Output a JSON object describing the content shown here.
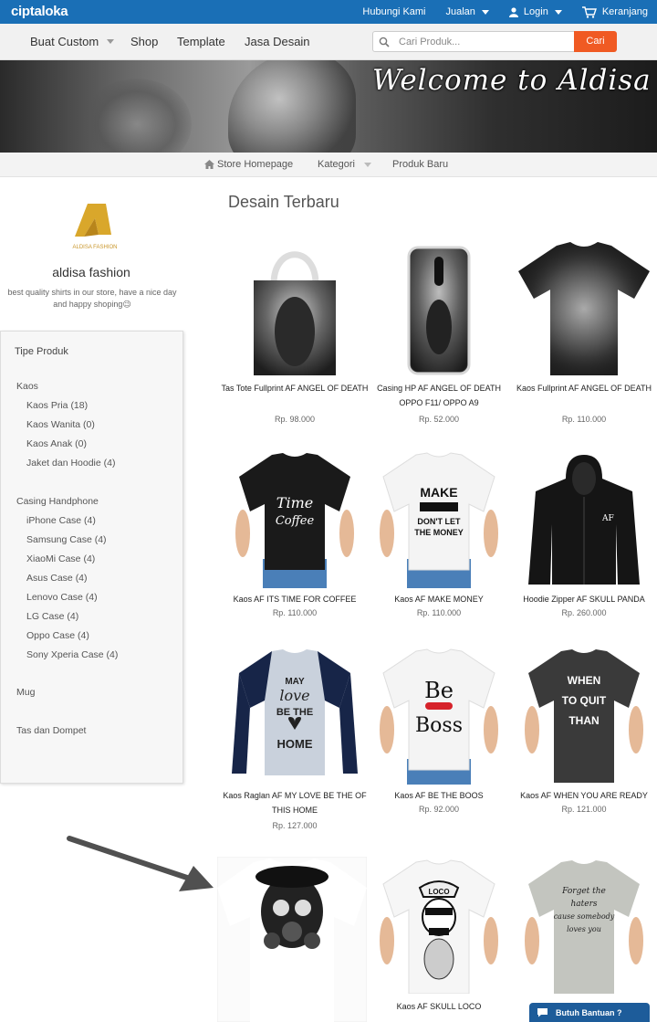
{
  "topbar": {
    "logo": "ciptaloka",
    "contact": "Hubungi Kami",
    "sell": "Jualan",
    "login": "Login",
    "cart": "Keranjang",
    "bg_color": "#1a6fb6"
  },
  "mainnav": {
    "custom": "Buat Custom",
    "shop": "Shop",
    "template": "Template",
    "design": "Jasa Desain",
    "search_placeholder": "Cari Produk...",
    "search_button": "Cari",
    "accent": "#f05a23"
  },
  "banner": {
    "title": "Welcome to Aldisa"
  },
  "storenav": {
    "home": "Store Homepage",
    "category": "Kategori",
    "new": "Produk Baru"
  },
  "store": {
    "logo_text": "ALDISA FASHION",
    "name": "aldisa fashion",
    "tagline": "best quality shirts in our store, have a nice day and happy shoping😉"
  },
  "filter": {
    "title": "Tipe Produk",
    "groups": [
      {
        "label": "Kaos",
        "items": [
          "Kaos Pria  (18)",
          "Kaos Wanita (0)",
          "Kaos Anak (0)",
          "Jaket dan Hoodie  (4)"
        ]
      },
      {
        "label": "Casing Handphone",
        "items": [
          "iPhone Case  (4)",
          "Samsung Case  (4)",
          "XiaoMi Case  (4)",
          "Asus Case  (4)",
          "Lenovo Case  (4)",
          "LG Case  (4)",
          "Oppo Case  (4)",
          "Sony Xperia Case  (4)"
        ]
      },
      {
        "label": "Mug",
        "items": []
      },
      {
        "label": "Tas dan Dompet",
        "items": []
      }
    ]
  },
  "products": {
    "heading": "Desain Terbaru",
    "items": [
      {
        "name": "Tas Tote Fullprint AF ANGEL OF DEATH",
        "price": "Rp. 98.000",
        "icon": "tote-bag-image"
      },
      {
        "name": "Casing HP AF ANGEL OF DEATH OPPO F11/ OPPO A9",
        "price": "Rp. 52.000",
        "icon": "phone-case-image"
      },
      {
        "name": "Kaos Fullprint AF ANGEL OF DEATH",
        "price": "Rp. 110.000",
        "icon": "black-tshirt-image"
      },
      {
        "name": "Kaos AF ITS TIME FOR COFFEE",
        "price": "Rp. 110.000",
        "icon": "black-tshirt-image"
      },
      {
        "name": "Kaos AF MAKE MONEY",
        "price": "Rp. 110.000",
        "icon": "white-tshirt-image"
      },
      {
        "name": "Hoodie Zipper AF SKULL PANDA",
        "price": "Rp. 260.000",
        "icon": "black-hoodie-image"
      },
      {
        "name": "Kaos Raglan AF MY LOVE BE THE OF THIS HOME",
        "price": "Rp. 127.000",
        "icon": "raglan-tshirt-image"
      },
      {
        "name": "Kaos AF BE THE BOOS",
        "price": "Rp. 92.000",
        "icon": "white-tshirt-image"
      },
      {
        "name": "Kaos AF WHEN YOU ARE READY",
        "price": "Rp. 121.000",
        "icon": "dark-grey-tshirt-image"
      },
      {
        "name": "",
        "price": "",
        "icon": "white-tshirt-image"
      },
      {
        "name": "Kaos AF SKULL LOCO",
        "price": "",
        "icon": "white-tshirt-image"
      },
      {
        "name": "",
        "price": "",
        "icon": "grey-tshirt-image"
      }
    ]
  },
  "help": {
    "label": "Butuh Bantuan ?"
  }
}
